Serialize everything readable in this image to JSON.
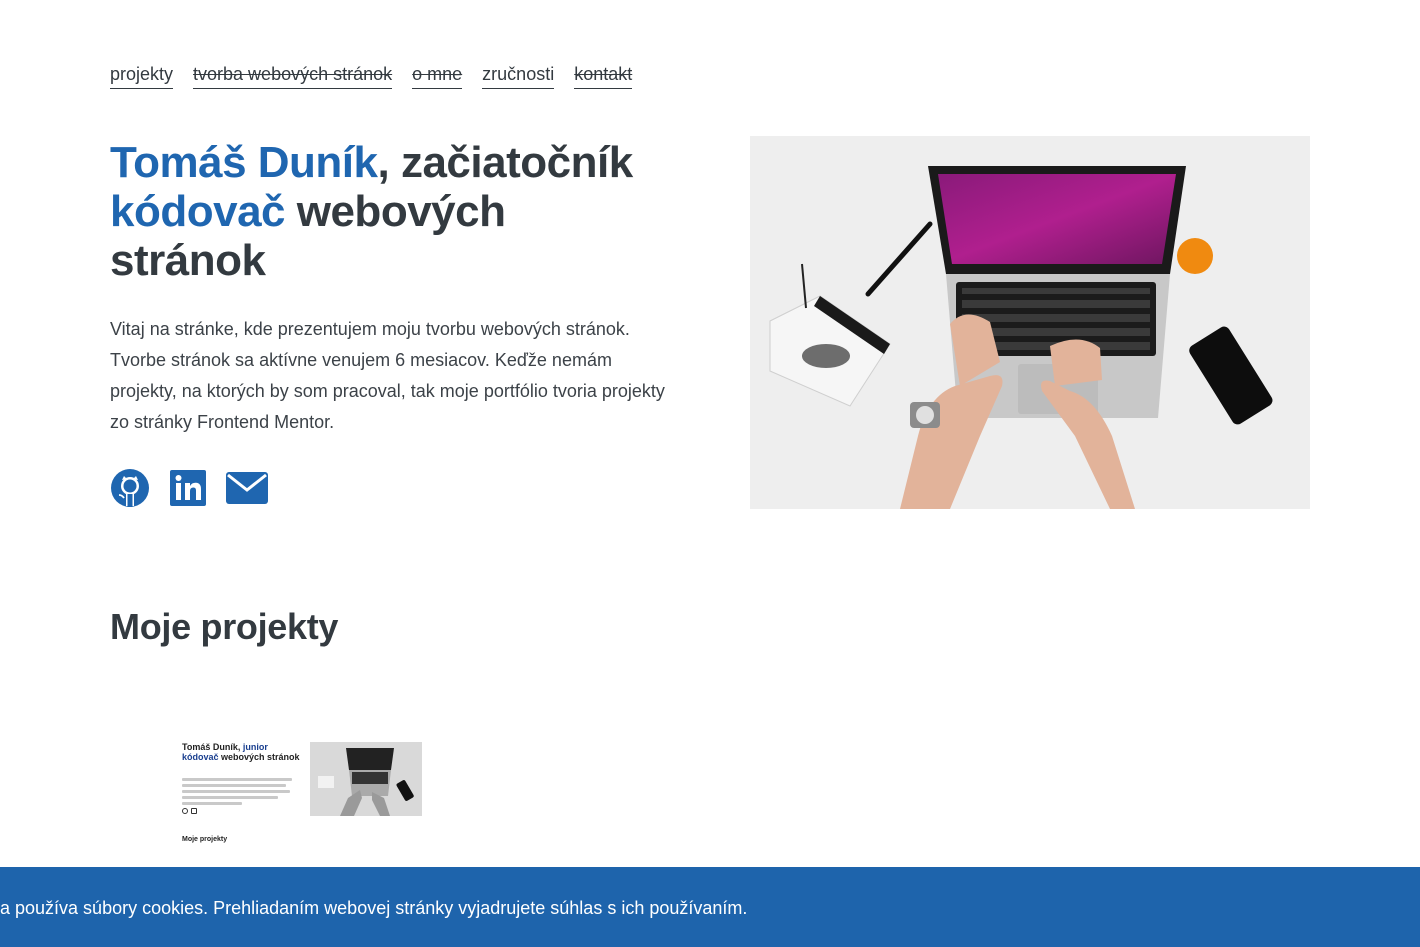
{
  "nav": {
    "items": [
      {
        "label": "projekty",
        "struck": false
      },
      {
        "label": "tvorba webových stránok",
        "struck": true
      },
      {
        "label": "o mne",
        "struck": true
      },
      {
        "label": "zručnosti",
        "struck": false
      },
      {
        "label": "kontakt",
        "struck": true
      }
    ]
  },
  "hero": {
    "title_name": "Tomáš Duník",
    "title_part2": ", začiatočník ",
    "title_accent2": "kódovač",
    "title_part3": " webových stránok",
    "intro": "Vitaj na stránke, kde prezentujem moju tvorbu webových stránok. Tvorbe stránok sa aktívne venujem 6 mesiacov. Keďže nemám projekty, na ktorých by som pracoval, tak moje portfólio tvoria projekty zo stránky Frontend Mentor.",
    "socials": [
      "github-icon",
      "linkedin-icon",
      "mail-icon"
    ],
    "accent_color": "#1f66b0"
  },
  "projects": {
    "heading": "Moje projekty",
    "thumbnail": {
      "title_name": "Tomáš Duník, ",
      "title_accent": "junior kódovač",
      "title_rest": " webových stránok",
      "subheading": "Moje projekty"
    }
  },
  "cookie": {
    "text": "a používa súbory cookies. Prehliadaním webovej stránky vyjadrujete súhlas s ich používaním.",
    "background": "#1e64ac"
  }
}
